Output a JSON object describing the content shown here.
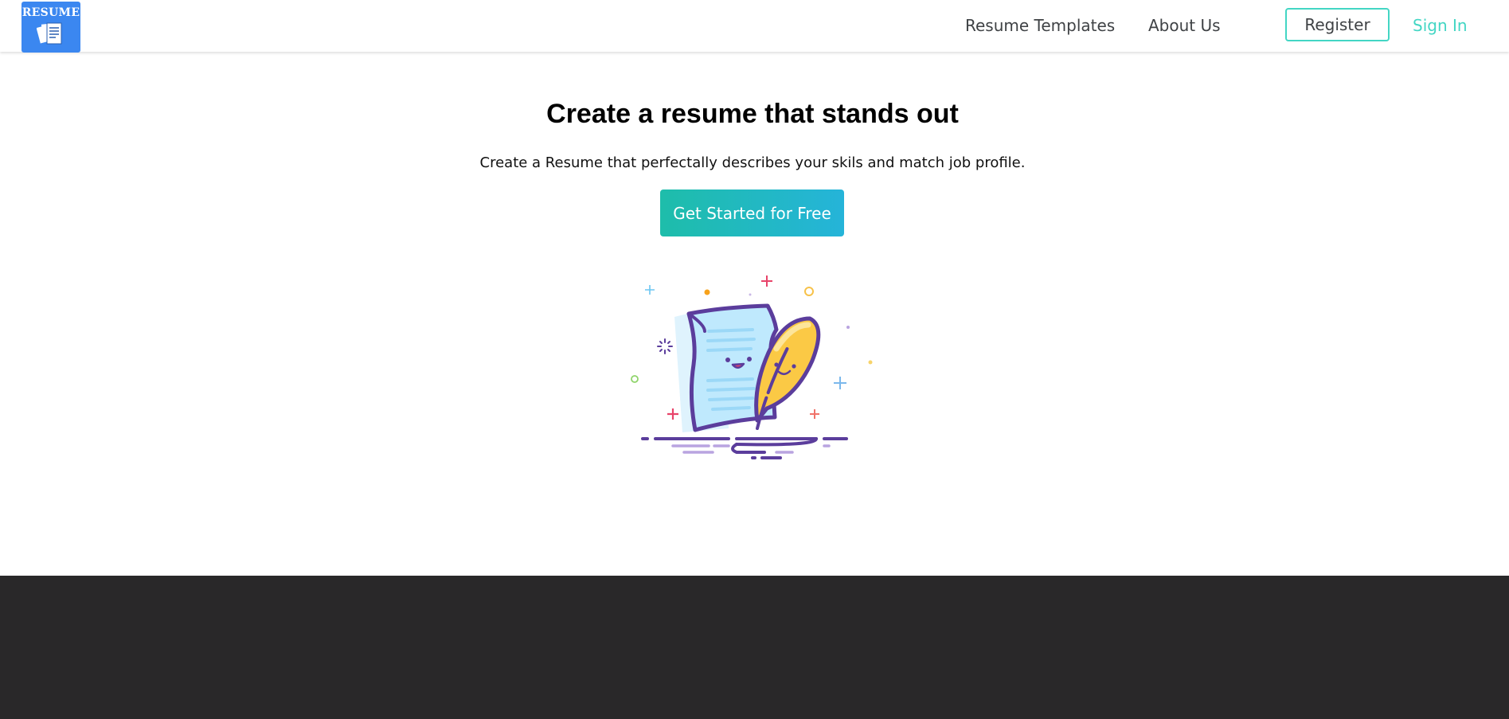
{
  "header": {
    "logo_text": "RESUME",
    "nav": {
      "resume_templates": "Resume Templates",
      "about_us": "About Us"
    },
    "register_label": "Register",
    "sign_in_label": "Sign In"
  },
  "hero": {
    "title": "Create a resume that stands out",
    "subtitle": "Create a Resume that perfectally describes your skils and match job profile.",
    "cta_label": "Get Started for Free",
    "illustration_icon": "document-and-quill-icon"
  },
  "colors": {
    "accent_teal": "#43d6c4",
    "cta_gradient_start": "#1ebdaa",
    "cta_gradient_end": "#25b4d9",
    "logo_blue": "#3b87f0",
    "footer_dark": "#292829"
  }
}
